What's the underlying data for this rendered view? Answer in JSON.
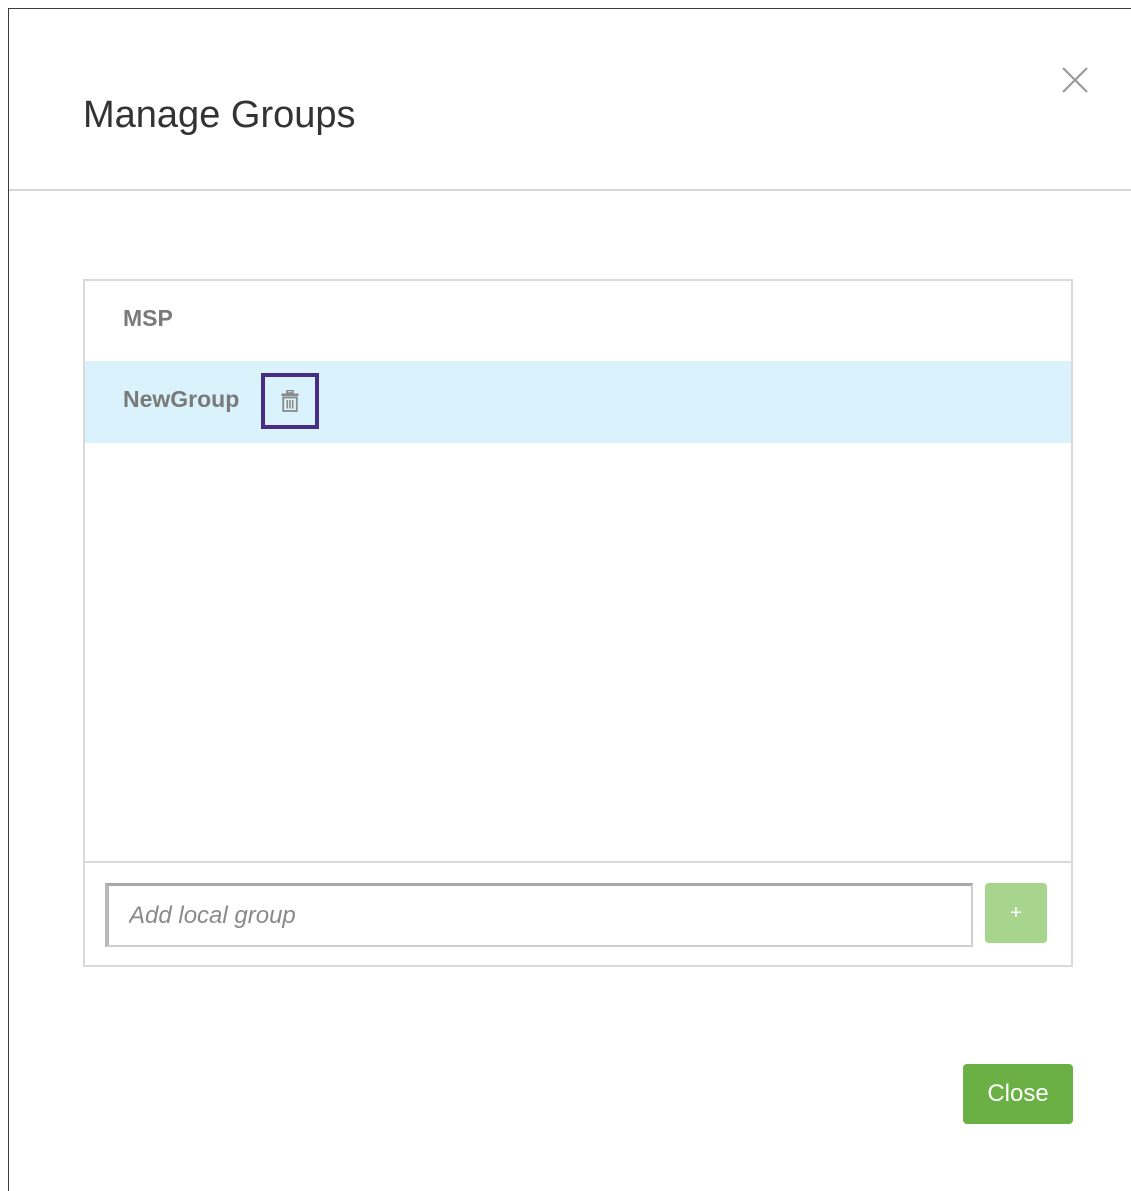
{
  "dialog": {
    "title": "Manage Groups",
    "close_icon": "close-x-icon"
  },
  "groups": {
    "items": [
      {
        "name": "MSP",
        "selected": false
      },
      {
        "name": "NewGroup",
        "selected": true,
        "action_icon": "trash-icon"
      }
    ],
    "selected_bg": "#d9f2fb",
    "highlight_color": "#4b2c84"
  },
  "add_group": {
    "placeholder": "Add local group",
    "value": "",
    "button_label": "+",
    "button_color": "#a8d58e"
  },
  "footer": {
    "close_label": "Close",
    "close_color": "#6ab045"
  }
}
